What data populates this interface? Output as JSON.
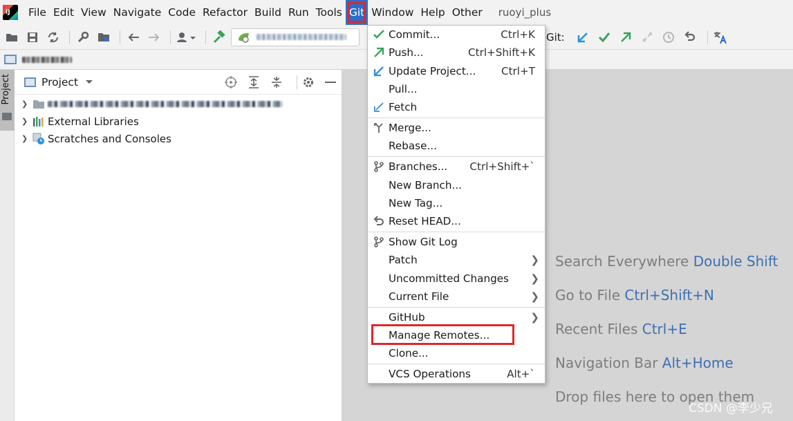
{
  "menubar": {
    "items": [
      "File",
      "Edit",
      "View",
      "Navigate",
      "Code",
      "Refactor",
      "Build",
      "Run",
      "Tools",
      "Git",
      "Window",
      "Help",
      "Other"
    ],
    "active": "Git",
    "project_name": "ruoyi_plus"
  },
  "toolbar": {
    "git_label": "Git:"
  },
  "project_panel": {
    "title": "Project",
    "tree": [
      {
        "label": "External Libraries",
        "icon": "library-icon"
      },
      {
        "label": "Scratches and Consoles",
        "icon": "scratches-icon"
      }
    ]
  },
  "git_menu": {
    "items": [
      {
        "label": "Commit...",
        "shortcut": "Ctrl+K",
        "icon": "check-icon"
      },
      {
        "label": "Push...",
        "shortcut": "Ctrl+Shift+K",
        "icon": "push-arrow-icon"
      },
      {
        "label": "Update Project...",
        "shortcut": "Ctrl+T",
        "icon": "update-arrow-icon"
      },
      {
        "label": "Pull...",
        "shortcut": "",
        "icon": ""
      },
      {
        "label": "Fetch",
        "shortcut": "",
        "icon": "fetch-icon"
      },
      {
        "label": "Merge...",
        "shortcut": "",
        "icon": "merge-icon"
      },
      {
        "label": "Rebase...",
        "shortcut": "",
        "icon": ""
      },
      {
        "label": "Branches...",
        "shortcut": "Ctrl+Shift+`",
        "icon": "branch-icon"
      },
      {
        "label": "New Branch...",
        "shortcut": "",
        "icon": ""
      },
      {
        "label": "New Tag...",
        "shortcut": "",
        "icon": ""
      },
      {
        "label": "Reset HEAD...",
        "shortcut": "",
        "icon": "reset-icon"
      },
      {
        "label": "Show Git Log",
        "shortcut": "",
        "icon": "git-log-icon"
      },
      {
        "label": "Patch",
        "shortcut": "",
        "icon": "",
        "submenu": true
      },
      {
        "label": "Uncommitted Changes",
        "shortcut": "",
        "icon": "",
        "submenu": true
      },
      {
        "label": "Current File",
        "shortcut": "",
        "icon": "",
        "submenu": true
      },
      {
        "label": "GitHub",
        "shortcut": "",
        "icon": "",
        "submenu": true
      },
      {
        "label": "Manage Remotes...",
        "shortcut": "",
        "icon": "",
        "highlighted": true
      },
      {
        "label": "Clone...",
        "shortcut": "",
        "icon": ""
      },
      {
        "label": "VCS Operations",
        "shortcut": "Alt+`",
        "icon": ""
      }
    ]
  },
  "editor_hints": [
    {
      "text": "Search Everywhere",
      "shortcut": "Double Shift"
    },
    {
      "text": "Go to File",
      "shortcut": "Ctrl+Shift+N"
    },
    {
      "text": "Recent Files",
      "shortcut": "Ctrl+E"
    },
    {
      "text": "Navigation Bar",
      "shortcut": "Alt+Home"
    },
    {
      "text": "Drop files here to open them",
      "shortcut": ""
    }
  ],
  "watermark": "CSDN @李少兄",
  "colors": {
    "menu_active_bg": "#2e6ec8",
    "highlight_border": "#e0262b",
    "shortcut_blue": "#3e6fb2",
    "git_green": "#3aa35a",
    "git_blue": "#2e8fe0"
  }
}
